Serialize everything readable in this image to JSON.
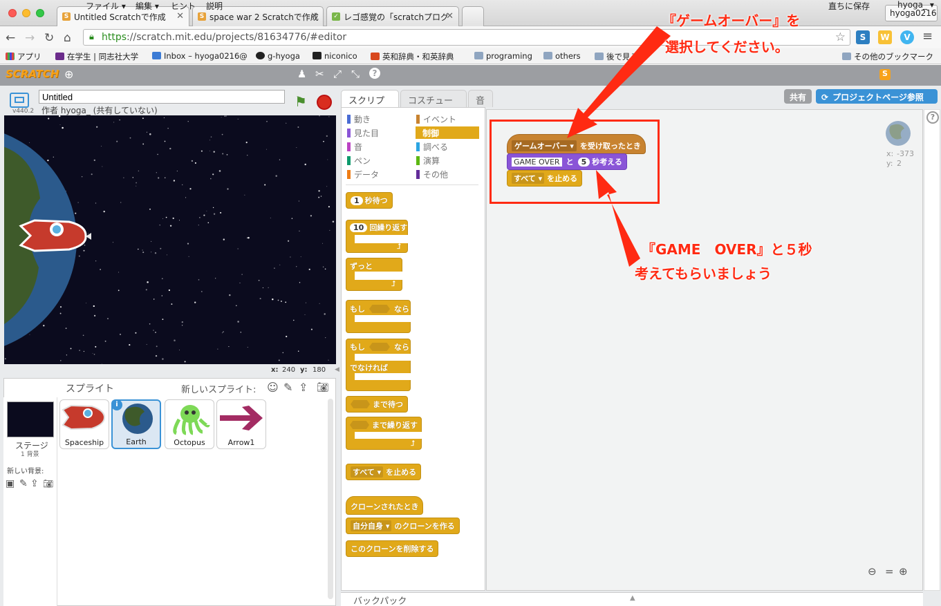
{
  "browser": {
    "tabs": [
      {
        "title": "Untitled Scratchで作成",
        "favicon": "scratch-favicon"
      },
      {
        "title": "space war 2 Scratchで作成",
        "favicon": "scratch-favicon"
      },
      {
        "title": "レゴ感覚の「scratchプログ",
        "favicon": "leaf-favicon"
      }
    ],
    "profile": "hyoga0216",
    "url_scheme": "https",
    "url_rest": "://scratch.mit.edu/projects/81634776/#editor",
    "bookmarks": [
      {
        "label": "アプリ",
        "icon": "apps-icon"
      },
      {
        "label": "在学生 | 同志社大学",
        "icon": "doshisha-icon"
      },
      {
        "label": "Inbox – hyoga0216@",
        "icon": "mail-icon"
      },
      {
        "label": "g-hyoga",
        "icon": "github-icon"
      },
      {
        "label": "niconico",
        "icon": "tv-icon"
      },
      {
        "label": "英和辞典・和英辞典",
        "icon": "weblio-icon"
      },
      {
        "label": "programing",
        "icon": "folder-icon"
      },
      {
        "label": "others",
        "icon": "folder-icon"
      },
      {
        "label": "後で見る",
        "icon": "folder-icon"
      },
      {
        "label": "その他のブックマーク",
        "icon": "folder-icon"
      }
    ]
  },
  "scratch": {
    "logo": "SCRATCH",
    "menu": {
      "file": "ファイル ▾",
      "edit": "編集 ▾",
      "hint": "ヒント",
      "about": "説明"
    },
    "save_now": "直ちに保存",
    "user": "hyoga_ ▾",
    "share": "共有",
    "project_page": "プロジェクトページ参照",
    "project_title": "Untitled",
    "author": "作者 hyoga_ (共有していない)",
    "version": "v440.2",
    "stage_x": "240",
    "stage_y": "180",
    "x_label": "x:",
    "y_label": "y:",
    "sprites_header": "スプライト",
    "new_sprite": "新しいスプライト:",
    "stage_label": "ステージ",
    "backdrop_count": "1 背景",
    "new_backdrop": "新しい背景:",
    "sprites": [
      "Spaceship",
      "Earth",
      "Octopus",
      "Arrow1"
    ],
    "selected_sprite": "Earth",
    "editor_tabs": [
      "スクリプト",
      "コスチューム",
      "音"
    ],
    "categories_left": [
      {
        "label": "動き",
        "color": "#4a6cd4"
      },
      {
        "label": "見た目",
        "color": "#8a55d7"
      },
      {
        "label": "音",
        "color": "#bb42c3"
      },
      {
        "label": "ペン",
        "color": "#0e9a6c"
      },
      {
        "label": "データ",
        "color": "#ee7d16"
      }
    ],
    "categories_right": [
      {
        "label": "イベント",
        "color": "#c88330"
      },
      {
        "label": "制御",
        "color": "#e1a91a"
      },
      {
        "label": "調べる",
        "color": "#2ca5e2"
      },
      {
        "label": "演算",
        "color": "#5cb712"
      },
      {
        "label": "その他",
        "color": "#632d99"
      }
    ],
    "palette": {
      "wait_num": "1",
      "wait": "秒待つ",
      "repeat_num": "10",
      "repeat": "回繰り返す",
      "forever": "ずっと",
      "if": "もし",
      "then": "なら",
      "if2": "もし",
      "then2": "なら",
      "else": "でなければ",
      "wait_until": "まで待つ",
      "repeat_until": "まで繰り返す",
      "stop_opt": "すべて ▾",
      "stop": "を止める",
      "clone_start": "クローンされたとき",
      "clone_opt": "自分自身 ▾",
      "clone_create": "のクローンを作る",
      "clone_delete": "このクローンを削除する"
    },
    "script": {
      "hat_msg": "ゲームオーバー ▾",
      "hat": "を受け取ったとき",
      "think_text": "GAME OVER",
      "think_and": "と",
      "think_secs": "5",
      "think": "秒考える",
      "stop_opt": "すべて ▾",
      "stop": "を止める"
    },
    "sprite_info_x_label": "x:",
    "sprite_info_x": "-373",
    "sprite_info_y_label": "y:",
    "sprite_info_y": "2",
    "backpack": "バックパック"
  },
  "annotations": {
    "top_line1": "『ゲームオーバー』を",
    "top_line2": "選択してください。",
    "mid_line1": "『GAME　OVER』と５秒",
    "mid_line2": "考えてもらいましょう",
    "color": "#ff2a12"
  }
}
